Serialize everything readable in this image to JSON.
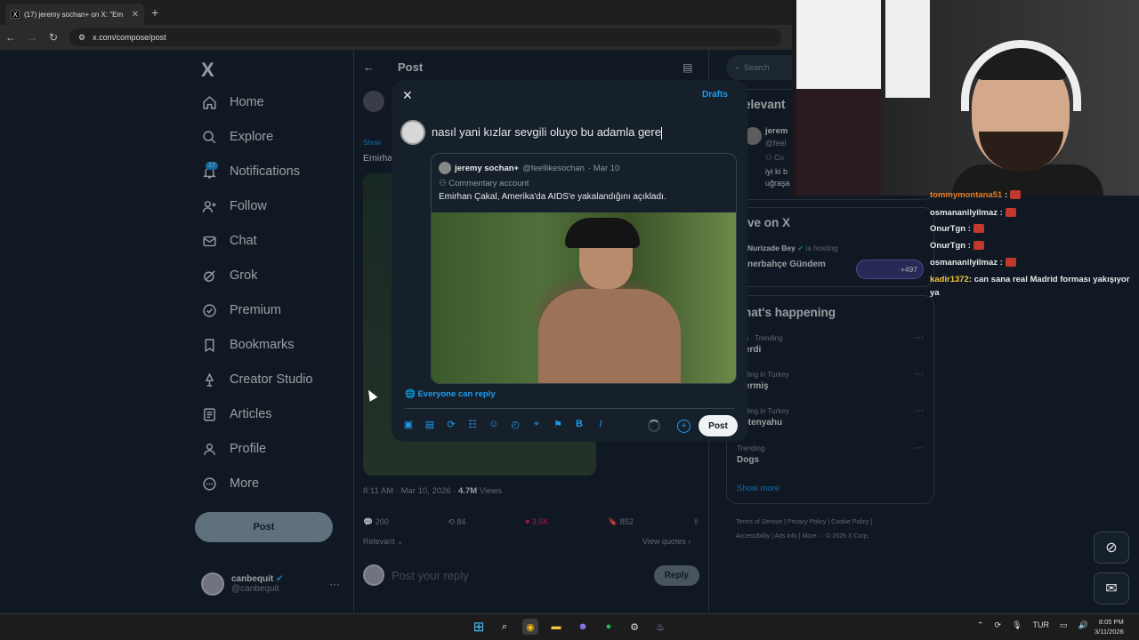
{
  "browser": {
    "tab_title": "(17) jeremy sochan+ on X: \"Em",
    "tab_favicon": "X",
    "url": "x.com/compose/post"
  },
  "nav": {
    "logo": "X",
    "notif_count": "17",
    "items": [
      {
        "label": "Home",
        "icon": "home-icon"
      },
      {
        "label": "Explore",
        "icon": "search-icon"
      },
      {
        "label": "Notifications",
        "icon": "bell-icon"
      },
      {
        "label": "Follow",
        "icon": "person-plus-icon"
      },
      {
        "label": "Chat",
        "icon": "mail-icon"
      },
      {
        "label": "Grok",
        "icon": "grok-icon"
      },
      {
        "label": "Premium",
        "icon": "verified-icon"
      },
      {
        "label": "Bookmarks",
        "icon": "bookmark-icon"
      },
      {
        "label": "Creator Studio",
        "icon": "studio-icon"
      },
      {
        "label": "Articles",
        "icon": "article-icon"
      },
      {
        "label": "Profile",
        "icon": "person-icon"
      },
      {
        "label": "More",
        "icon": "more-circle-icon"
      }
    ],
    "post_label": "Post",
    "account": {
      "name": "canbequit",
      "handle": "@canbequit"
    }
  },
  "center": {
    "title": "Post",
    "show_label": "Show",
    "emirha": "Emirha",
    "timestamp": "8:11 AM · Mar 10, 2026 · ",
    "views_count": "4.7M",
    "views_label": " Views",
    "replies": "200",
    "reposts": "84",
    "likes": "3.6K",
    "bookmarks": "852",
    "relevant": "Relevant",
    "view_quotes": "View quotes",
    "reply_placeholder": "Post your reply",
    "reply_button": "Reply"
  },
  "right": {
    "search_placeholder": "Search",
    "relevant_title": "elevant",
    "rel_user_snip": "jerem",
    "rel_handle_snip": "@feel",
    "rel_co_snip": "Co",
    "rel_bio_1": "iyi ki b",
    "rel_bio_2": "uğraşa",
    "live_title": "ve on X",
    "live_host": "Nurizade Bey",
    "live_is_hosting": " is hosting",
    "live_topic": "nerbahçe Gündem",
    "live_count": "+497",
    "happening_title": "hat's happening",
    "trends": [
      {
        "meta": "orts · Trending",
        "name": "Iberdi"
      },
      {
        "meta": "ending in Turkey",
        "name": "ibermiş"
      },
      {
        "meta": "ending in Turkey",
        "name": "Netenyahu"
      },
      {
        "meta": "Trending",
        "name": "Dogs"
      }
    ],
    "show_more": "Show more",
    "footer": [
      "Terms of Service",
      "Privacy Policy",
      "Cookie Policy",
      "Accessibility",
      "Ads info",
      "More ···",
      "© 2026 X Corp."
    ]
  },
  "compose": {
    "close_icon": "close-icon",
    "drafts": "Drafts",
    "text": "nasıl yani kızlar sevgili oluyo bu adamla gere",
    "quote": {
      "name": "jeremy sochan+",
      "handle": "@feellikesochan",
      "date": "· Mar 10",
      "label": "Commentary account",
      "text": "Emirhan Çakal, Amerika'da AIDS'e yakalandığını açıkladı."
    },
    "reply_setting": "Everyone can reply",
    "post_button": "Post",
    "tool_icons": [
      "image-icon",
      "gif-icon",
      "grok-icon",
      "poll-icon",
      "emoji-icon",
      "schedule-icon",
      "location-icon",
      "flag-icon",
      "bold-icon",
      "italic-icon"
    ]
  },
  "stream_chat": [
    {
      "user": "tommymontana51",
      "msg": ":",
      "color": "#e67e22"
    },
    {
      "user": "osmananilyilmaz",
      "msg": ":",
      "color": "#ffffff"
    },
    {
      "user": "OnurTgn",
      "msg": ":",
      "color": "#ffffff"
    },
    {
      "user": "OnurTgn",
      "msg": ":",
      "color": "#ffffff"
    },
    {
      "user": "osmananilyilmaz",
      "msg": ":",
      "color": "#ffffff"
    },
    {
      "user": "kadir1372",
      "msg": ": can sana real Madrid forması yakışıyor",
      "color": "#f5c542"
    },
    {
      "user": "",
      "msg": "ya",
      "color": "#ffffff"
    }
  ],
  "taskbar": {
    "lang": "TUR",
    "time": "8:05 PM",
    "date": "3/11/2026"
  },
  "colors": {
    "accent": "#1d9bf0",
    "bg": "#15202b",
    "like": "#f91880"
  }
}
